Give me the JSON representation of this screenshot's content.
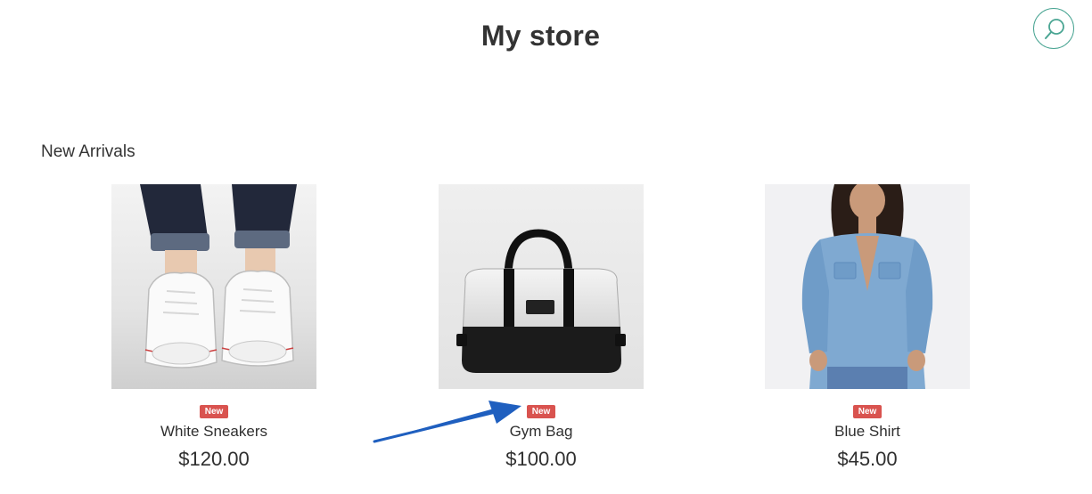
{
  "header": {
    "title": "My store",
    "search_icon": "search-icon"
  },
  "section": {
    "title": "New Arrivals"
  },
  "products": [
    {
      "name": "White Sneakers",
      "price": "$120.00",
      "badge": "New",
      "image": "sneakers-photo"
    },
    {
      "name": "Gym Bag",
      "price": "$100.00",
      "badge": "New",
      "image": "gym-bag-photo"
    },
    {
      "name": "Blue Shirt",
      "price": "$45.00",
      "badge": "New",
      "image": "denim-shirt-photo"
    }
  ],
  "colors": {
    "badge": "#d9534f",
    "search_border": "#4aa593",
    "annotation_arrow": "#1f5fbf"
  }
}
